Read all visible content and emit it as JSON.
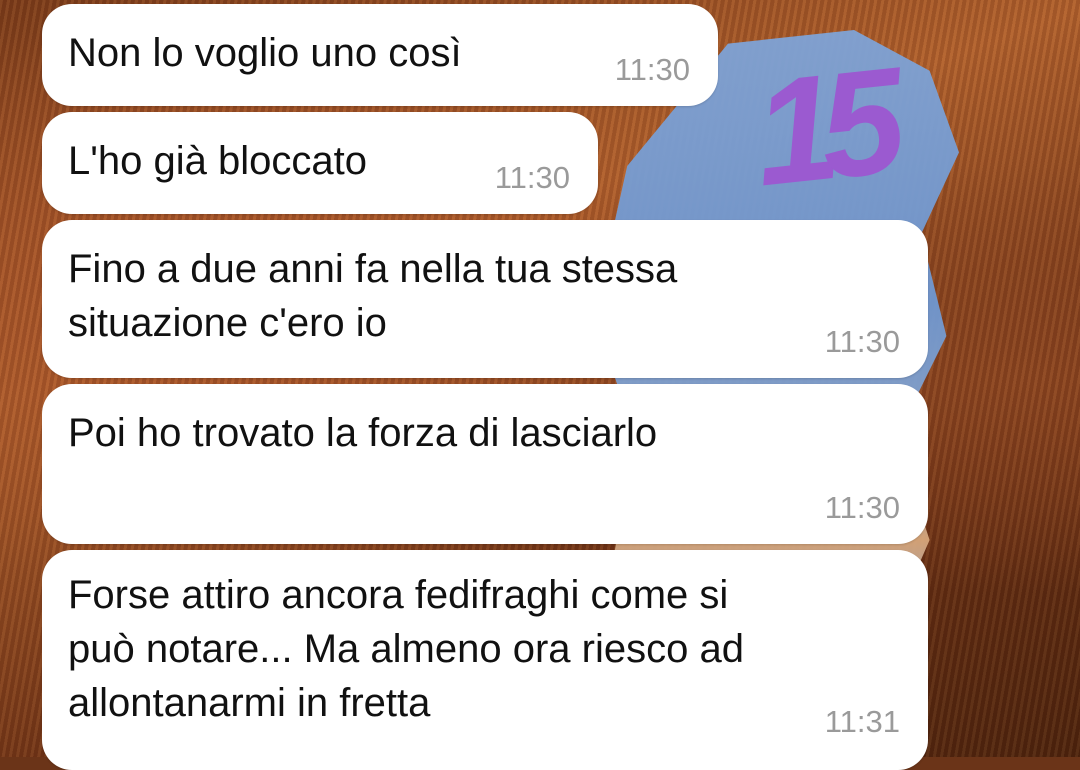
{
  "overlay": {
    "number": "15"
  },
  "colors": {
    "bubble": "#ffffff",
    "text": "#111111",
    "time": "#9a9a9a",
    "overlay_number": "#9b5ad0"
  },
  "messages": [
    {
      "text": "Non lo voglio uno così",
      "time": "11:30"
    },
    {
      "text": "L'ho già bloccato",
      "time": "11:30"
    },
    {
      "text": "Fino a due anni fa nella tua stessa\nsituazione c'ero io",
      "time": "11:30"
    },
    {
      "text": "Poi ho trovato la forza di lasciarlo",
      "time": "11:30"
    },
    {
      "text": "Forse attiro ancora fedifraghi come si\npuò notare... Ma almeno ora riesco ad\nallontanarmi in fretta",
      "time": "11:31"
    }
  ]
}
